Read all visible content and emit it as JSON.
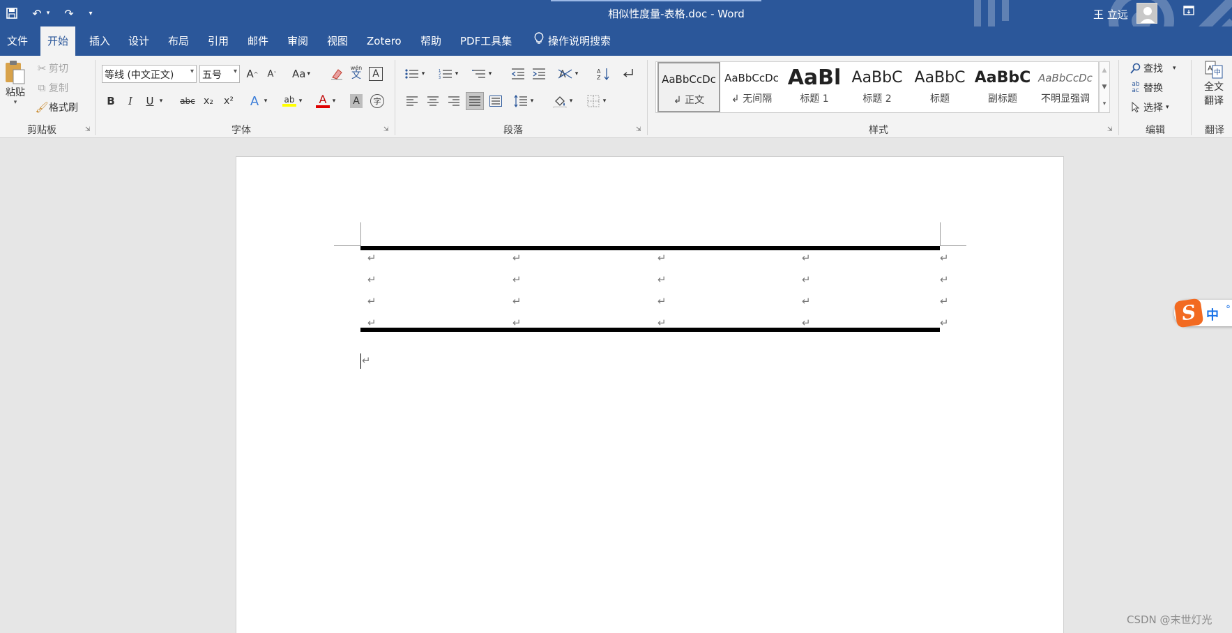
{
  "titlebar": {
    "document_title": "相似性度量-表格.doc  -  Word",
    "user_name": "王 立远"
  },
  "tabs": [
    "文件",
    "开始",
    "插入",
    "设计",
    "布局",
    "引用",
    "邮件",
    "审阅",
    "视图",
    "Zotero",
    "帮助",
    "PDF工具集"
  ],
  "tell_me": "操作说明搜索",
  "clipboard": {
    "paste": "粘贴",
    "cut": "剪切",
    "copy": "复制",
    "format_painter": "格式刷",
    "label": "剪贴板"
  },
  "font": {
    "font_name": "等线 (中文正文)",
    "font_size": "五号",
    "label": "字体",
    "change_case": "Aa",
    "phonetic": "wén",
    "bold": "B",
    "italic": "I",
    "underline": "U",
    "strike": "abc",
    "subscript": "x₂",
    "superscript": "x²",
    "font_color": "A"
  },
  "paragraph": {
    "label": "段落"
  },
  "styles": {
    "label": "样式",
    "items": [
      {
        "sample": "AaBbCcDc",
        "name": "↲ 正文"
      },
      {
        "sample": "AaBbCcDc",
        "name": "↲ 无间隔"
      },
      {
        "sample": "AaBl",
        "name": "标题 1"
      },
      {
        "sample": "AaBbC",
        "name": "标题 2"
      },
      {
        "sample": "AaBbC",
        "name": "标题"
      },
      {
        "sample": "AaBbC",
        "name": "副标题"
      },
      {
        "sample": "AaBbCcDc",
        "name": "不明显强调"
      }
    ]
  },
  "editing": {
    "find": "查找",
    "replace": "替换",
    "select": "选择",
    "label": "编辑"
  },
  "translate": {
    "full_text": "全文",
    "translate": "翻译",
    "label": "翻译"
  },
  "document": {
    "paragraph_mark": "↵",
    "table_rows": 4,
    "table_cols": 5
  },
  "ime": {
    "lang": "中",
    "extra": "°"
  },
  "watermark": "CSDN @末世灯光",
  "colors": {
    "word_blue": "#2b579a",
    "ribbon_bg": "#f3f3f3",
    "highlight_yellow": "#ffff00",
    "font_red": "#e00000",
    "sogou_orange": "#f26a21"
  }
}
